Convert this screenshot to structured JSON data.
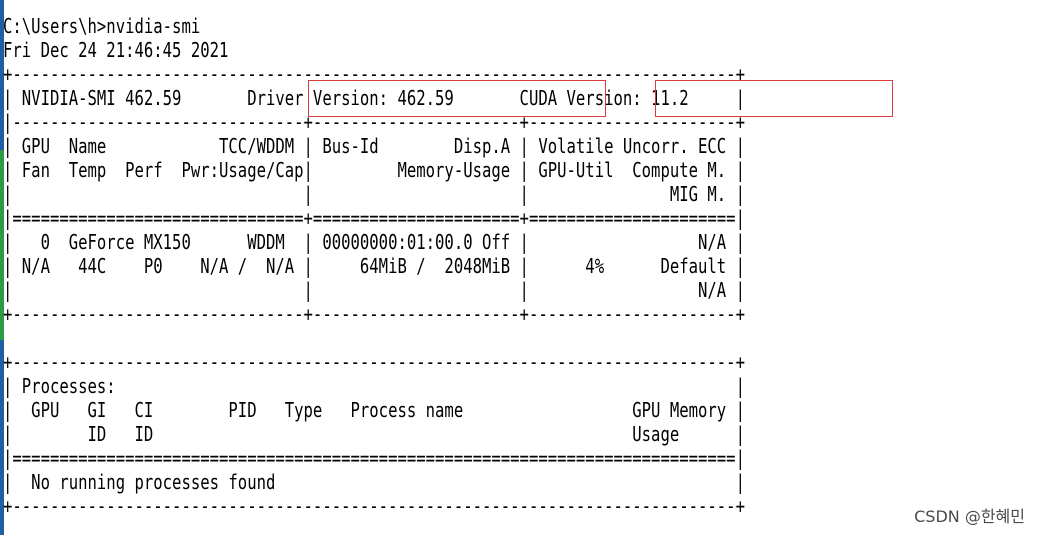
{
  "terminal": {
    "prompt": "C:\\Users\\h>nvidia-smi",
    "timestamp": "Fri Dec 24 21:46:45 2021",
    "lines": [
      "+-----------------------------------------------------------------------------+",
      "| NVIDIA-SMI 462.59       Driver Version: 462.59       CUDA Version: 11.2     |",
      "|-------------------------------+----------------------+----------------------+",
      "| GPU  Name            TCC/WDDM | Bus-Id        Disp.A | Volatile Uncorr. ECC |",
      "| Fan  Temp  Perf  Pwr:Usage/Cap|         Memory-Usage | GPU-Util  Compute M. |",
      "|                               |                      |               MIG M. |",
      "|===============================+======================+======================|",
      "|   0  GeForce MX150      WDDM  | 00000000:01:00.0 Off |                  N/A |",
      "| N/A   44C    P0    N/A /  N/A |     64MiB /  2048MiB |      4%      Default |",
      "|                               |                      |                  N/A |",
      "+-------------------------------+----------------------+----------------------+",
      "",
      "+-----------------------------------------------------------------------------+",
      "| Processes:                                                                  |",
      "|  GPU   GI   CI        PID   Type   Process name                  GPU Memory |",
      "|        ID   ID                                                   Usage      |",
      "|=============================================================================|",
      "|  No running processes found                                                 |",
      "+-----------------------------------------------------------------------------+"
    ]
  },
  "summary": {
    "smi_version": "NVIDIA-SMI 462.59",
    "driver_version": "Driver Version: 462.59",
    "cuda_version": "CUDA Version: 11.2"
  },
  "gpu": {
    "index": "0",
    "name": "GeForce MX150",
    "mode": "WDDM",
    "bus_id": "00000000:01:00.0",
    "display_active": "Off",
    "volatile_ecc": "N/A",
    "fan": "N/A",
    "temp": "44C",
    "perf": "P0",
    "power": "N/A /  N/A",
    "memory_usage": "64MiB /  2048MiB",
    "gpu_util": "4%",
    "compute_mode": "Default",
    "mig_mode": "N/A"
  },
  "processes": {
    "header": "Processes:",
    "columns": [
      "GPU",
      "GI ID",
      "CI ID",
      "PID",
      "Type",
      "Process name",
      "GPU Memory Usage"
    ],
    "message": "No running processes found"
  },
  "watermark": "CSDN @한혜민",
  "colors": {
    "background": "#ffffff",
    "text": "#000000",
    "highlight_box": "#e03b3b",
    "edge_stripe": [
      "#1f5fa6",
      "#2f9a45",
      "#1f5fa6"
    ]
  }
}
